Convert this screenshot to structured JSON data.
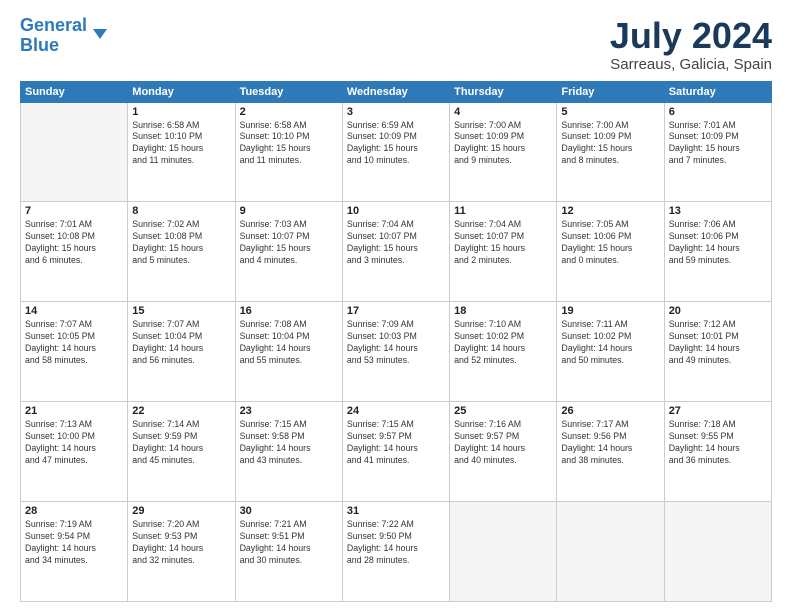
{
  "header": {
    "logo_line1": "General",
    "logo_line2": "Blue",
    "month_year": "July 2024",
    "location": "Sarreaus, Galicia, Spain"
  },
  "weekdays": [
    "Sunday",
    "Monday",
    "Tuesday",
    "Wednesday",
    "Thursday",
    "Friday",
    "Saturday"
  ],
  "weeks": [
    [
      {
        "day": "",
        "info": ""
      },
      {
        "day": "1",
        "info": "Sunrise: 6:58 AM\nSunset: 10:10 PM\nDaylight: 15 hours\nand 11 minutes."
      },
      {
        "day": "2",
        "info": "Sunrise: 6:58 AM\nSunset: 10:10 PM\nDaylight: 15 hours\nand 11 minutes."
      },
      {
        "day": "3",
        "info": "Sunrise: 6:59 AM\nSunset: 10:09 PM\nDaylight: 15 hours\nand 10 minutes."
      },
      {
        "day": "4",
        "info": "Sunrise: 7:00 AM\nSunset: 10:09 PM\nDaylight: 15 hours\nand 9 minutes."
      },
      {
        "day": "5",
        "info": "Sunrise: 7:00 AM\nSunset: 10:09 PM\nDaylight: 15 hours\nand 8 minutes."
      },
      {
        "day": "6",
        "info": "Sunrise: 7:01 AM\nSunset: 10:09 PM\nDaylight: 15 hours\nand 7 minutes."
      }
    ],
    [
      {
        "day": "7",
        "info": "Sunrise: 7:01 AM\nSunset: 10:08 PM\nDaylight: 15 hours\nand 6 minutes."
      },
      {
        "day": "8",
        "info": "Sunrise: 7:02 AM\nSunset: 10:08 PM\nDaylight: 15 hours\nand 5 minutes."
      },
      {
        "day": "9",
        "info": "Sunrise: 7:03 AM\nSunset: 10:07 PM\nDaylight: 15 hours\nand 4 minutes."
      },
      {
        "day": "10",
        "info": "Sunrise: 7:04 AM\nSunset: 10:07 PM\nDaylight: 15 hours\nand 3 minutes."
      },
      {
        "day": "11",
        "info": "Sunrise: 7:04 AM\nSunset: 10:07 PM\nDaylight: 15 hours\nand 2 minutes."
      },
      {
        "day": "12",
        "info": "Sunrise: 7:05 AM\nSunset: 10:06 PM\nDaylight: 15 hours\nand 0 minutes."
      },
      {
        "day": "13",
        "info": "Sunrise: 7:06 AM\nSunset: 10:06 PM\nDaylight: 14 hours\nand 59 minutes."
      }
    ],
    [
      {
        "day": "14",
        "info": "Sunrise: 7:07 AM\nSunset: 10:05 PM\nDaylight: 14 hours\nand 58 minutes."
      },
      {
        "day": "15",
        "info": "Sunrise: 7:07 AM\nSunset: 10:04 PM\nDaylight: 14 hours\nand 56 minutes."
      },
      {
        "day": "16",
        "info": "Sunrise: 7:08 AM\nSunset: 10:04 PM\nDaylight: 14 hours\nand 55 minutes."
      },
      {
        "day": "17",
        "info": "Sunrise: 7:09 AM\nSunset: 10:03 PM\nDaylight: 14 hours\nand 53 minutes."
      },
      {
        "day": "18",
        "info": "Sunrise: 7:10 AM\nSunset: 10:02 PM\nDaylight: 14 hours\nand 52 minutes."
      },
      {
        "day": "19",
        "info": "Sunrise: 7:11 AM\nSunset: 10:02 PM\nDaylight: 14 hours\nand 50 minutes."
      },
      {
        "day": "20",
        "info": "Sunrise: 7:12 AM\nSunset: 10:01 PM\nDaylight: 14 hours\nand 49 minutes."
      }
    ],
    [
      {
        "day": "21",
        "info": "Sunrise: 7:13 AM\nSunset: 10:00 PM\nDaylight: 14 hours\nand 47 minutes."
      },
      {
        "day": "22",
        "info": "Sunrise: 7:14 AM\nSunset: 9:59 PM\nDaylight: 14 hours\nand 45 minutes."
      },
      {
        "day": "23",
        "info": "Sunrise: 7:15 AM\nSunset: 9:58 PM\nDaylight: 14 hours\nand 43 minutes."
      },
      {
        "day": "24",
        "info": "Sunrise: 7:15 AM\nSunset: 9:57 PM\nDaylight: 14 hours\nand 41 minutes."
      },
      {
        "day": "25",
        "info": "Sunrise: 7:16 AM\nSunset: 9:57 PM\nDaylight: 14 hours\nand 40 minutes."
      },
      {
        "day": "26",
        "info": "Sunrise: 7:17 AM\nSunset: 9:56 PM\nDaylight: 14 hours\nand 38 minutes."
      },
      {
        "day": "27",
        "info": "Sunrise: 7:18 AM\nSunset: 9:55 PM\nDaylight: 14 hours\nand 36 minutes."
      }
    ],
    [
      {
        "day": "28",
        "info": "Sunrise: 7:19 AM\nSunset: 9:54 PM\nDaylight: 14 hours\nand 34 minutes."
      },
      {
        "day": "29",
        "info": "Sunrise: 7:20 AM\nSunset: 9:53 PM\nDaylight: 14 hours\nand 32 minutes."
      },
      {
        "day": "30",
        "info": "Sunrise: 7:21 AM\nSunset: 9:51 PM\nDaylight: 14 hours\nand 30 minutes."
      },
      {
        "day": "31",
        "info": "Sunrise: 7:22 AM\nSunset: 9:50 PM\nDaylight: 14 hours\nand 28 minutes."
      },
      {
        "day": "",
        "info": ""
      },
      {
        "day": "",
        "info": ""
      },
      {
        "day": "",
        "info": ""
      }
    ]
  ]
}
